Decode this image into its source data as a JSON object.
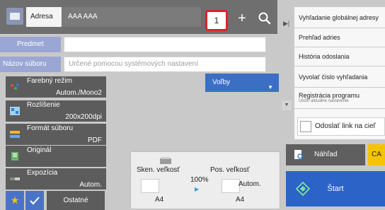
{
  "address_bar": {
    "tab_label": "Adresa",
    "address_value": "AAA AAA",
    "destination_count": "1",
    "plus_label": "+"
  },
  "form": {
    "subject_label": "Predmet",
    "subject_value": "",
    "filename_label": "Názov súboru",
    "filename_placeholder": "Určené pomocou systémových nastavení"
  },
  "options_label": "Voľby",
  "settings": [
    {
      "title": "Farebný režim",
      "value": "Autom./Mono2",
      "icon": "color-mode-icon"
    },
    {
      "title": "Rozlíšenie",
      "value": "200x200dpi",
      "icon": "resolution-icon"
    },
    {
      "title": "Formát súboru",
      "value": "PDF",
      "icon": "file-format-icon"
    },
    {
      "title": "Originál",
      "value": "",
      "icon": "original-icon"
    },
    {
      "title": "Expozícia",
      "value": "Autom.",
      "icon": "exposure-icon"
    }
  ],
  "preview_panel": {
    "scan_size_label": "Sken. veľkosť",
    "send_size_label": "Pos. veľkosť",
    "ratio": "100%",
    "scan_size_value": "A4",
    "send_size_auto": "Autom.",
    "send_size_value": "A4"
  },
  "bottom": {
    "others_label": "Ostatné"
  },
  "right_panel": {
    "items": [
      {
        "label": "Vyhľadanie globálnej adresy",
        "sub": ""
      },
      {
        "label": "Prehľad adries",
        "sub": ""
      },
      {
        "label": "História odoslania",
        "sub": ""
      },
      {
        "label": "Vyvolať číslo vyhľadania",
        "sub": ""
      },
      {
        "label": "Registrácia programu",
        "sub": "Uložiť aktuálne nastavenie"
      }
    ],
    "send_link_label": "Odoslať link na cieľ"
  },
  "actions": {
    "preview_label": "Náhľad",
    "ca_label": "CA",
    "start_label": "Štart"
  },
  "colors": {
    "count_highlight": "#d8252b",
    "start_button": "#2b63c6",
    "ca_button": "#f5c400"
  }
}
